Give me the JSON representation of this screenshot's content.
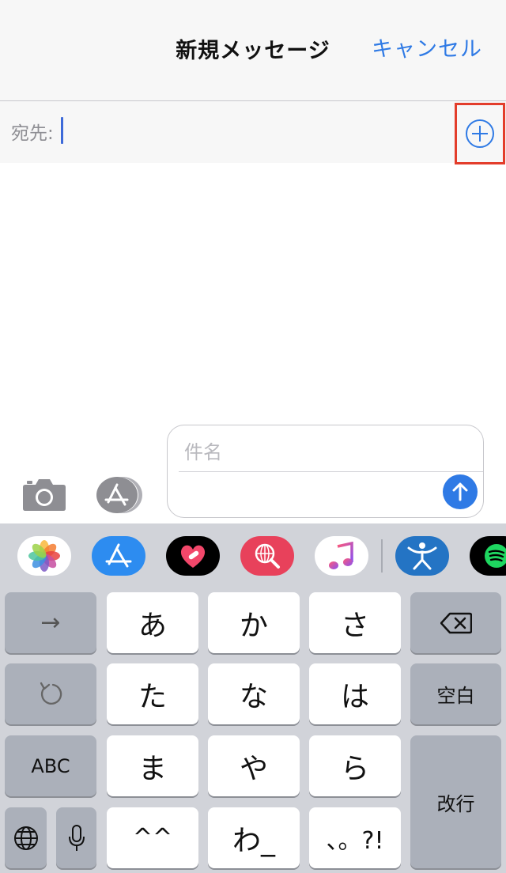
{
  "header": {
    "title": "新規メッセージ",
    "cancel_label": "キャンセル"
  },
  "recipient": {
    "label": "宛先:"
  },
  "compose": {
    "subject_placeholder": "件名"
  },
  "icons": {
    "add_contact": "plus-circle-icon",
    "camera": "camera-icon",
    "app_store": "app-store-icon",
    "send": "arrow-up-icon"
  },
  "app_strip": [
    {
      "name": "photos"
    },
    {
      "name": "app-store"
    },
    {
      "name": "digital-touch-heart"
    },
    {
      "name": "images-search"
    },
    {
      "name": "music"
    },
    {
      "name": "fitness-figure"
    },
    {
      "name": "spotify"
    }
  ],
  "keyboard": {
    "row1": [
      "→",
      "あ",
      "か",
      "さ",
      "⌫"
    ],
    "row2": [
      "↺",
      "た",
      "な",
      "は",
      "空白"
    ],
    "row3": [
      "ABC",
      "ま",
      "や",
      "ら",
      "改行"
    ],
    "row4": [
      "🌐",
      "🎤",
      "^^",
      "わ_",
      "、。?!"
    ],
    "space_label": "空白",
    "abc_label": "ABC",
    "return_label": "改行"
  },
  "colors": {
    "accent": "#2f7ae5",
    "highlight_box": "#e33d2b",
    "keyboard_bg": "#d1d3d9"
  }
}
